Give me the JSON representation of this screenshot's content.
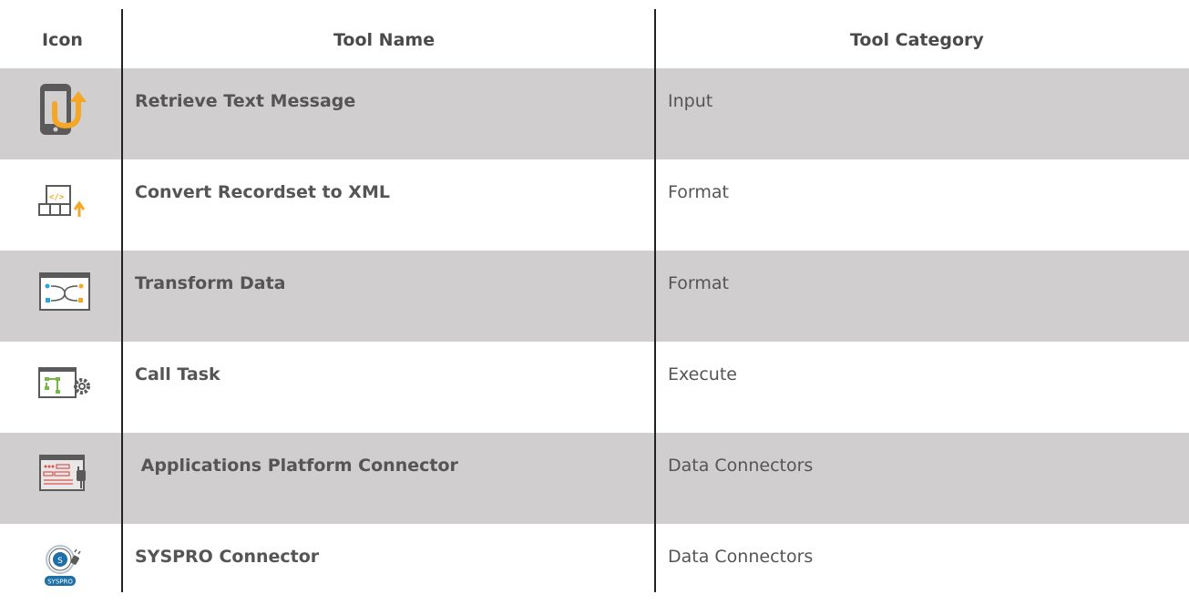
{
  "header": {
    "icon_label": "Icon",
    "name_label": "Tool Name",
    "category_label": "Tool Category"
  },
  "rows": [
    {
      "icon": "mobile-retrieve-icon",
      "name": "Retrieve Text Message",
      "category": "Input"
    },
    {
      "icon": "xml-convert-icon",
      "name": "Convert Recordset to XML",
      "category": "Format"
    },
    {
      "icon": "transform-data-icon",
      "name": "Transform Data",
      "category": "Format"
    },
    {
      "icon": "call-task-icon",
      "name": "Call Task",
      "category": "Execute"
    },
    {
      "icon": "applications-platform-connector-icon",
      "name": " Applications Platform Connector",
      "category": "Data Connectors"
    },
    {
      "icon": "syspro-connector-icon",
      "name": "SYSPRO Connector",
      "category": "Data Connectors",
      "logo_text": "SYSPRO"
    }
  ],
  "colors": {
    "shaded_row": "#d0cecf",
    "accent_orange": "#f5a623",
    "accent_blue": "#2aa7d6",
    "accent_green": "#7ab648",
    "accent_red": "#d9534f"
  }
}
